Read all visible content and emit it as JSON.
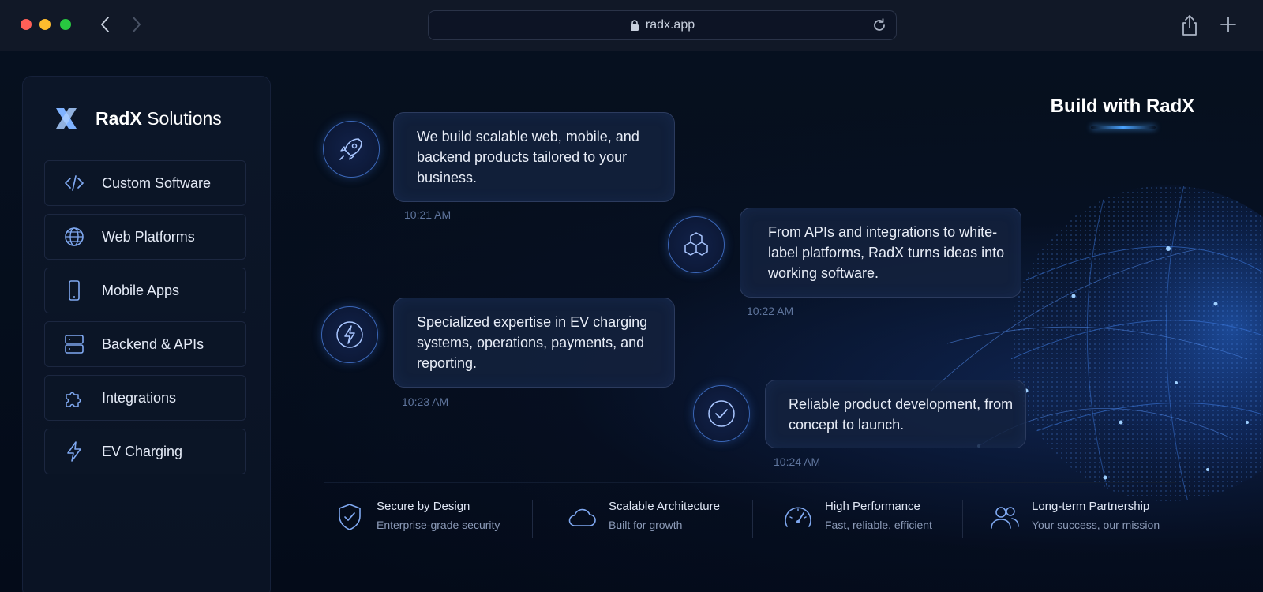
{
  "browser": {
    "url": "radx.app"
  },
  "sidebar": {
    "brand_bold": "RadX",
    "brand_rest": "Solutions",
    "items": [
      {
        "label": "Custom Software",
        "icon": "code-icon"
      },
      {
        "label": "Web Platforms",
        "icon": "globe-icon"
      },
      {
        "label": "Mobile Apps",
        "icon": "mobile-icon"
      },
      {
        "label": "Backend & APIs",
        "icon": "server-icon"
      },
      {
        "label": "Integrations",
        "icon": "puzzle-icon"
      },
      {
        "label": "EV Charging",
        "icon": "lightning-icon"
      }
    ]
  },
  "headline": "Build with RadX",
  "messages": [
    {
      "text": "We build scalable web, mobile, and backend products tailored to your business.",
      "time": "10:21 AM",
      "icon": "rocket-icon"
    },
    {
      "text": "From APIs and integrations to white-label platforms, RadX turns ideas into working software.",
      "time": "10:22 AM",
      "icon": "cubes-icon"
    },
    {
      "text": "Specialized expertise in EV charging systems, operations, payments, and reporting.",
      "time": "10:23 AM",
      "icon": "lightning-circle-icon"
    },
    {
      "text": "Reliable product development, from concept to launch.",
      "time": "10:24 AM",
      "icon": "check-circle-icon"
    }
  ],
  "features": [
    {
      "title": "Secure by Design",
      "subtitle": "Enterprise-grade security",
      "icon": "shield-check-icon"
    },
    {
      "title": "Scalable Architecture",
      "subtitle": "Built for growth",
      "icon": "cloud-icon"
    },
    {
      "title": "High Performance",
      "subtitle": "Fast, reliable, efficient",
      "icon": "speedometer-icon"
    },
    {
      "title": "Long-term Partnership",
      "subtitle": "Your success, our mission",
      "icon": "users-icon"
    }
  ],
  "colors": {
    "accent": "#4a8df0",
    "background": "#050a17",
    "panel": "#0c1628"
  }
}
